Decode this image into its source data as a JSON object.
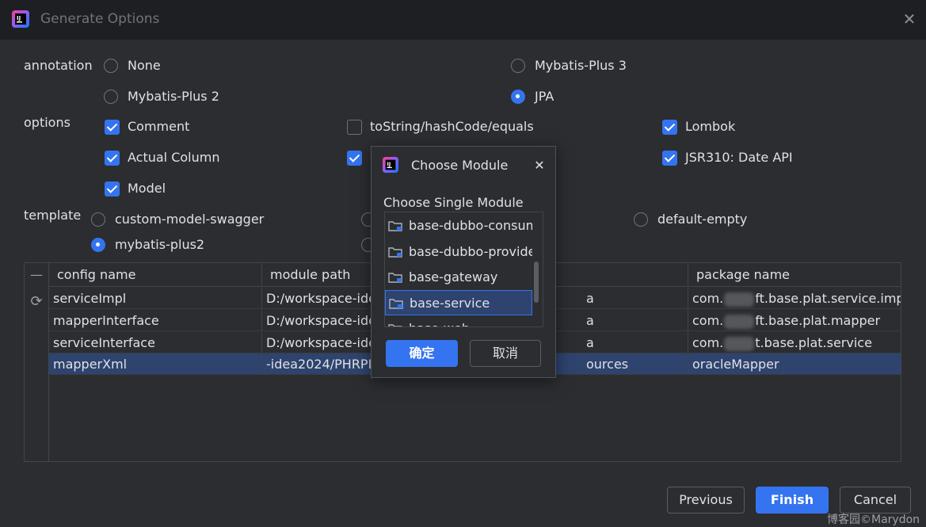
{
  "window": {
    "title": "Generate Options",
    "close_icon": "close-icon"
  },
  "annotation": {
    "label": "annotation",
    "options": [
      {
        "label": "None",
        "selected": false
      },
      {
        "label": "Mybatis-Plus 3",
        "selected": false
      },
      {
        "label": "Mybatis-Plus 2",
        "selected": false
      },
      {
        "label": "JPA",
        "selected": true
      }
    ]
  },
  "options": {
    "label": "options",
    "items": [
      {
        "label": "Comment",
        "checked": true
      },
      {
        "label": "toString/hashCode/equals",
        "checked": false
      },
      {
        "label": "Lombok",
        "checked": true
      },
      {
        "label": "Actual Column",
        "checked": true
      },
      {
        "label": "",
        "checked": true
      },
      {
        "label": "JSR310: Date API",
        "checked": true
      },
      {
        "label": "Model",
        "checked": true
      }
    ]
  },
  "template": {
    "label": "template",
    "options": [
      {
        "label": "custom-model-swagger",
        "selected": false
      },
      {
        "label": "",
        "selected": false
      },
      {
        "label": "default-empty",
        "selected": false
      },
      {
        "label": "mybatis-plus2",
        "selected": true
      },
      {
        "label": "",
        "selected": false
      }
    ]
  },
  "table": {
    "gutter_icons": {
      "collapse": "—",
      "refresh": "⟳"
    },
    "columns": [
      "config name",
      "module path",
      "",
      "package name"
    ],
    "rows": [
      {
        "config": "serviceImpl",
        "module": "D:/workspace-ide",
        "mid": "a",
        "package_prefix": "com.",
        "package_suffix": "ft.base.plat.service.impl",
        "selected": false
      },
      {
        "config": "mapperInterface",
        "module": "D:/workspace-ide",
        "mid": "a",
        "package_prefix": "com.",
        "package_suffix": "ft.base.plat.mapper",
        "selected": false
      },
      {
        "config": "serviceInterface",
        "module": "D:/workspace-ide",
        "mid": "a",
        "package_prefix": "com.",
        "package_suffix": "t.base.plat.service",
        "selected": false
      },
      {
        "config": "mapperXml",
        "module": "-idea2024/PHRPL",
        "mid": "ources",
        "package_prefix": "oracleMapper",
        "package_suffix": "",
        "selected": true
      }
    ]
  },
  "buttons": {
    "previous": "Previous",
    "finish": "Finish",
    "cancel": "Cancel"
  },
  "modal": {
    "title": "Choose Module",
    "subtitle": "Choose Single Module",
    "items": [
      {
        "label": "base-dubbo-consum",
        "selected": false
      },
      {
        "label": "base-dubbo-provider",
        "selected": false
      },
      {
        "label": "base-gateway",
        "selected": false
      },
      {
        "label": "base-service",
        "selected": true
      },
      {
        "label": "base-web",
        "selected": false
      }
    ],
    "ok_label": "确定",
    "cancel_label": "取消"
  },
  "watermark": "博客园©Marydon",
  "colors": {
    "accent": "#3574f0",
    "background": "#2b2d30",
    "titlebar": "#1e1f22",
    "selection": "#2e436e"
  }
}
